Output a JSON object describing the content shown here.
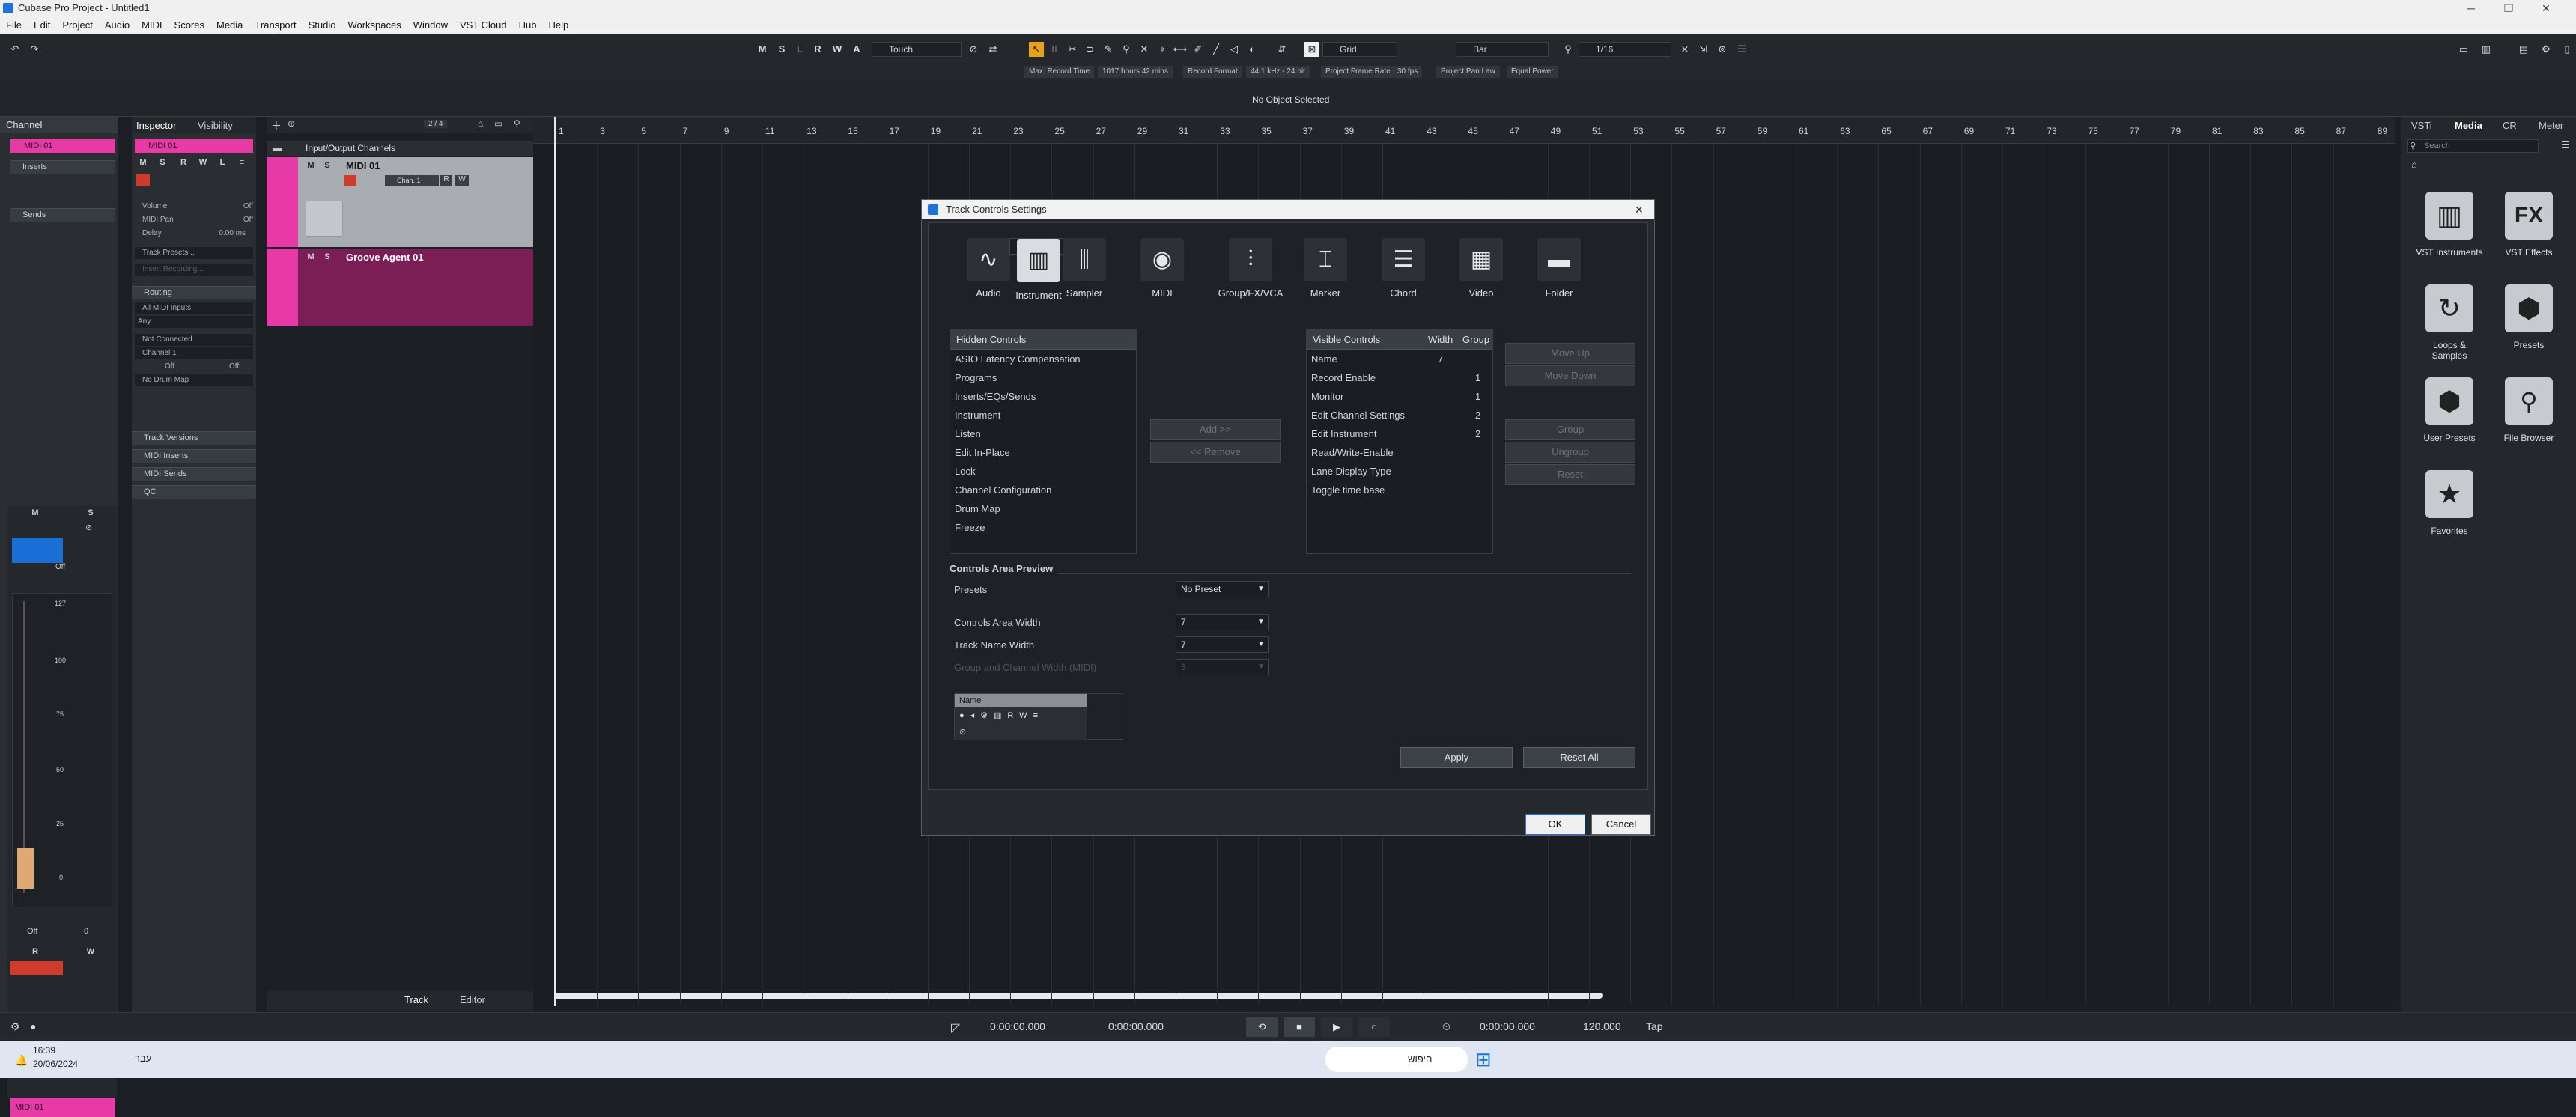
{
  "window": {
    "title": "Cubase Pro Project - Untitled1"
  },
  "menu": [
    "File",
    "Edit",
    "Project",
    "Audio",
    "MIDI",
    "Scores",
    "Media",
    "Transport",
    "Studio",
    "Workspaces",
    "Window",
    "VST Cloud",
    "Hub",
    "Help"
  ],
  "toolbar": {
    "ms_buttons": [
      "M",
      "S",
      "L",
      "R",
      "W",
      "A"
    ],
    "automation_mode": "Touch",
    "snap_type": "Grid",
    "grid_type": "Bar",
    "quantize": "1/16"
  },
  "status": {
    "max_record_time_label": "Max. Record Time",
    "max_record_time": "1017 hours 42 mins",
    "record_format_label": "Record Format",
    "record_format": "44.1 kHz - 24 bit",
    "frame_rate_label": "Project Frame Rate",
    "frame_rate": "30 fps",
    "pan_law_label": "Project Pan Law",
    "pan_law": "Equal Power"
  },
  "info_line": "No Object Selected",
  "left_zone": {
    "tab": "Channel",
    "track": "MIDI 01",
    "inserts": "Inserts",
    "sends": "Sends",
    "m": "M",
    "s": "S",
    "off": "Off",
    "fader_marks": [
      "127",
      "100",
      "75",
      "50",
      "25",
      "0"
    ],
    "r": "R",
    "w": "W",
    "off2": "Off",
    "zero": "0",
    "bottom_track": "MIDI 01"
  },
  "inspector": {
    "tab_inspector": "Inspector",
    "tab_visibility": "Visibility",
    "track": "MIDI 01",
    "volume": "Volume",
    "volume_val": "Off",
    "pan": "MIDI Pan",
    "pan_val": "Off",
    "delay": "Delay",
    "delay_val": "0.00 ms",
    "track_presets": "Track Presets...",
    "insert_recording": "Insert Recording...",
    "routing": "Routing",
    "all_midi_inputs": "All MIDI Inputs",
    "any": "Any",
    "not_connected": "Not Connected",
    "channel": "Channel 1",
    "off_a": "Off",
    "off_b": "Off",
    "no_drum_map": "No Drum Map",
    "track_versions": "Track Versions",
    "midi_inserts": "MIDI Inserts",
    "midi_sends": "MIDI Sends",
    "qc": "QC"
  },
  "tracklist": {
    "counter": "2 / 4",
    "folder": "Input/Output Channels",
    "track1": "MIDI 01",
    "track1_chan": "Chan. 1",
    "track2": "Groove Agent 01",
    "tab_track": "Track",
    "tab_editor": "Editor"
  },
  "ruler": [
    "1",
    "3",
    "5",
    "7",
    "9",
    "11",
    "13",
    "15",
    "17",
    "19",
    "21",
    "23",
    "25",
    "27",
    "29",
    "31",
    "33",
    "35",
    "37",
    "39",
    "41",
    "43",
    "45",
    "47",
    "49",
    "51",
    "53",
    "55",
    "57",
    "59",
    "61",
    "63",
    "65",
    "67",
    "69",
    "71",
    "73",
    "75",
    "77",
    "79",
    "81",
    "83",
    "85",
    "87",
    "89"
  ],
  "right_zone": {
    "tabs": [
      "VSTi",
      "Media",
      "CR",
      "Meter"
    ],
    "search": "Search",
    "items": [
      {
        "icon": "piano-icon",
        "label": "VST Instruments"
      },
      {
        "icon": "fx-icon",
        "label": "VST Effects"
      },
      {
        "icon": "loop-icon",
        "label": "Loops & Samples"
      },
      {
        "icon": "hex-icon",
        "label": "Presets"
      },
      {
        "icon": "user-hex-icon",
        "label": "User Presets"
      },
      {
        "icon": "browser-icon",
        "label": "File Browser"
      },
      {
        "icon": "star-icon",
        "label": "Favorites"
      }
    ]
  },
  "dialog": {
    "title": "Track Controls Settings",
    "types": [
      {
        "label": "Audio",
        "glyph": "∿"
      },
      {
        "label": "Instrument",
        "glyph": "▥"
      },
      {
        "label": "Sampler",
        "glyph": "⫼"
      },
      {
        "label": "MIDI",
        "glyph": "◉"
      },
      {
        "label": "Group/FX/VCA",
        "glyph": "⫶"
      },
      {
        "label": "Marker",
        "glyph": "⌶"
      },
      {
        "label": "Chord",
        "glyph": "☰"
      },
      {
        "label": "Video",
        "glyph": "▦"
      },
      {
        "label": "Folder",
        "glyph": "▬"
      }
    ],
    "hidden_header": "Hidden Controls",
    "hidden": [
      "ASIO Latency Compensation",
      "Programs",
      "Inserts/EQs/Sends",
      "Instrument",
      "Listen",
      "Edit In-Place",
      "Lock",
      "Channel Configuration",
      "Drum Map",
      "Freeze"
    ],
    "add": "Add >>",
    "remove": "<< Remove",
    "visible_header": "Visible Controls",
    "width_header": "Width",
    "group_header": "Group",
    "visible": [
      {
        "name": "Name",
        "width": "7",
        "group": ""
      },
      {
        "name": "Record Enable",
        "width": "",
        "group": "1"
      },
      {
        "name": "Monitor",
        "width": "",
        "group": "1"
      },
      {
        "name": "Edit Channel Settings",
        "width": "",
        "group": "2"
      },
      {
        "name": "Edit Instrument",
        "width": "",
        "group": "2"
      },
      {
        "name": "Read/Write-Enable",
        "width": "",
        "group": ""
      },
      {
        "name": "Lane Display Type",
        "width": "",
        "group": ""
      },
      {
        "name": "Toggle time base",
        "width": "",
        "group": ""
      }
    ],
    "move_up": "Move Up",
    "move_down": "Move Down",
    "group": "Group",
    "ungroup": "Ungroup",
    "reset": "Reset",
    "preview_title": "Controls Area Preview",
    "presets_label": "Presets",
    "presets_val": "No Preset",
    "area_width_label": "Controls Area Width",
    "area_width_val": "7",
    "name_width_label": "Track Name Width",
    "name_width_val": "7",
    "group_width_label": "Group and Channel Width (MIDI)",
    "group_width_val": "3",
    "preview_name": "Name",
    "preview_r": "R",
    "preview_w": "W",
    "apply": "Apply",
    "reset_all": "Reset All",
    "ok": "OK",
    "cancel": "Cancel"
  },
  "transport": {
    "pos_left": "0:00:00.000",
    "pos_right": "0:00:00.000",
    "pos_main": "0:00:00.000",
    "tempo": "120.000",
    "tap": "Tap"
  },
  "taskbar": {
    "time": "16:39",
    "date": "20/06/2024",
    "lang": "עבר",
    "search": "חיפוש"
  }
}
